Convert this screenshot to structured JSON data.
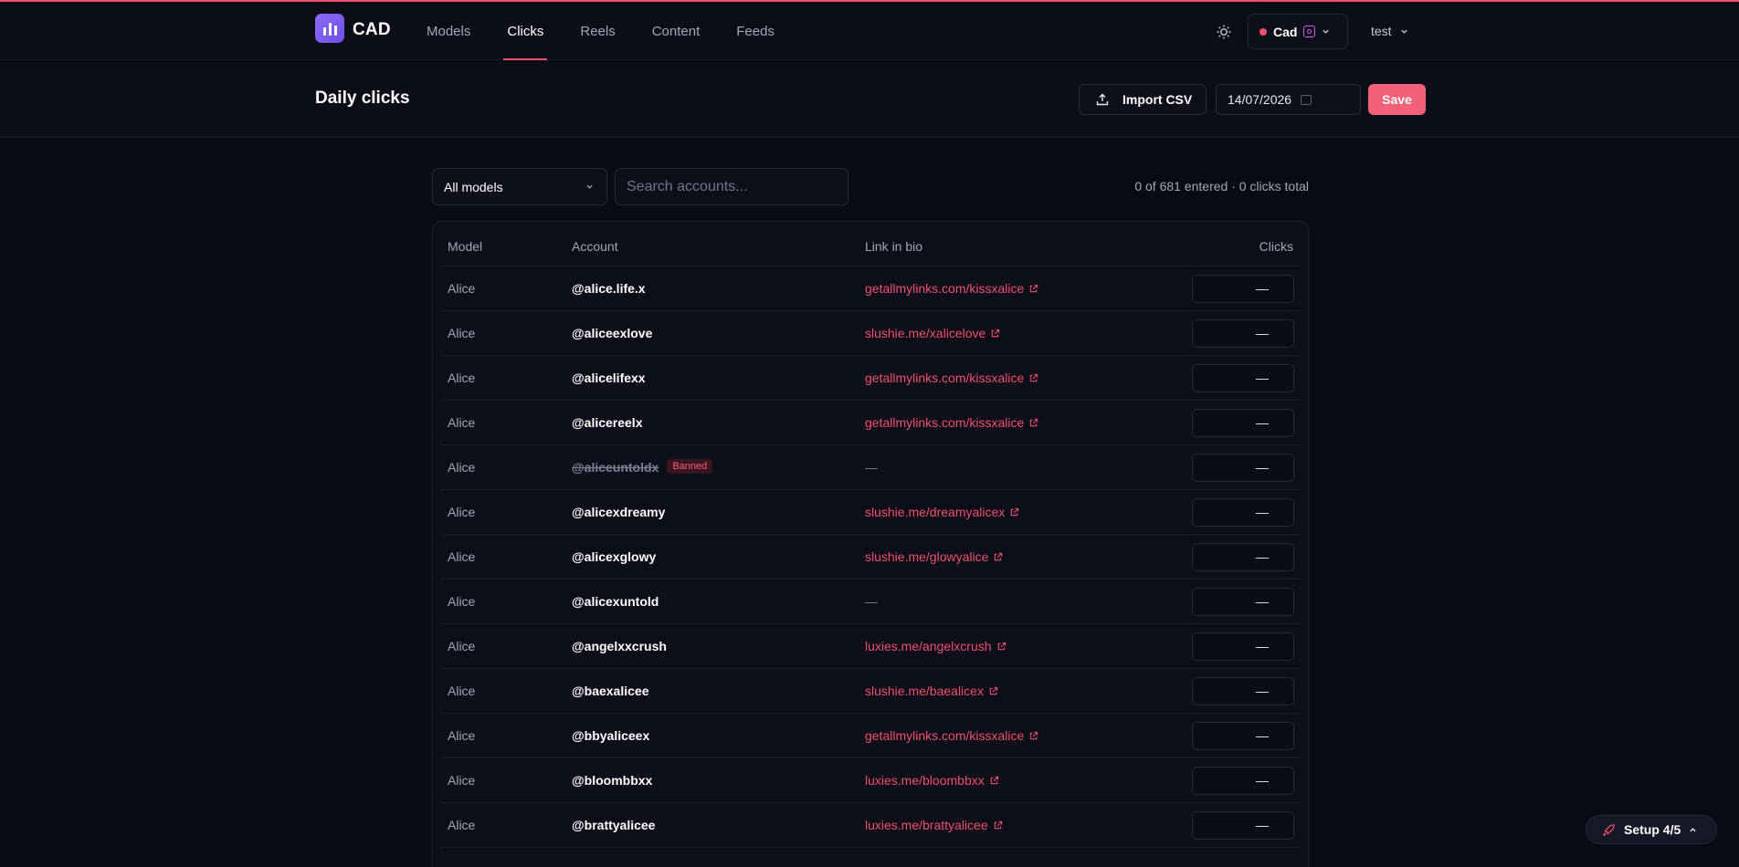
{
  "app": {
    "name": "CAD"
  },
  "nav": [
    {
      "label": "Models",
      "active": false
    },
    {
      "label": "Clicks",
      "active": true
    },
    {
      "label": "Reels",
      "active": false
    },
    {
      "label": "Content",
      "active": false
    },
    {
      "label": "Feeds",
      "active": false
    }
  ],
  "account_switcher": {
    "label": "Cad"
  },
  "user_menu": {
    "label": "test"
  },
  "page": {
    "title": "Daily clicks",
    "import_label": "Import CSV",
    "date_value": "14/07/2026",
    "save_label": "Save"
  },
  "filters": {
    "model_select": "All models",
    "search_placeholder": "Search accounts...",
    "summary": "0 of 681 entered · 0 clicks total"
  },
  "table": {
    "columns": [
      "Model",
      "Account",
      "Link in bio",
      "Clicks"
    ],
    "rows": [
      {
        "model": "Alice",
        "account": "@alice.life.x",
        "banned": false,
        "link": "getallmylinks.com/kissxalice",
        "clicks": "—"
      },
      {
        "model": "Alice",
        "account": "@aliceexlove",
        "banned": false,
        "link": "slushie.me/xalicelove",
        "clicks": "—"
      },
      {
        "model": "Alice",
        "account": "@alicelifexx",
        "banned": false,
        "link": "getallmylinks.com/kissxalice",
        "clicks": "—"
      },
      {
        "model": "Alice",
        "account": "@alicereelx",
        "banned": false,
        "link": "getallmylinks.com/kissxalice",
        "clicks": "—"
      },
      {
        "model": "Alice",
        "account": "@aliceuntoldx",
        "banned": true,
        "badge": "Banned",
        "link": "—",
        "clicks": "—"
      },
      {
        "model": "Alice",
        "account": "@alicexdreamy",
        "banned": false,
        "link": "slushie.me/dreamyalicex",
        "clicks": "—"
      },
      {
        "model": "Alice",
        "account": "@alicexglowy",
        "banned": false,
        "link": "slushie.me/glowyalice",
        "clicks": "—"
      },
      {
        "model": "Alice",
        "account": "@alicexuntold",
        "banned": false,
        "link": "—",
        "clicks": "—"
      },
      {
        "model": "Alice",
        "account": "@angelxxcrush",
        "banned": false,
        "link": "luxies.me/angelxcrush",
        "clicks": "—"
      },
      {
        "model": "Alice",
        "account": "@baexalicee",
        "banned": false,
        "link": "slushie.me/baealicex",
        "clicks": "—"
      },
      {
        "model": "Alice",
        "account": "@bbyaliceex",
        "banned": false,
        "link": "getallmylinks.com/kissxalice",
        "clicks": "—"
      },
      {
        "model": "Alice",
        "account": "@bloombbxx",
        "banned": false,
        "link": "luxies.me/bloombbxx",
        "clicks": "—"
      },
      {
        "model": "Alice",
        "account": "@brattyalicee",
        "banned": false,
        "link": "luxies.me/brattyalicee",
        "clicks": "—"
      }
    ]
  },
  "setup": {
    "label": "Setup 4/5"
  },
  "colors": {
    "accent": "#f0506e",
    "background": "#090b14",
    "logo": "#7b5cf0"
  }
}
